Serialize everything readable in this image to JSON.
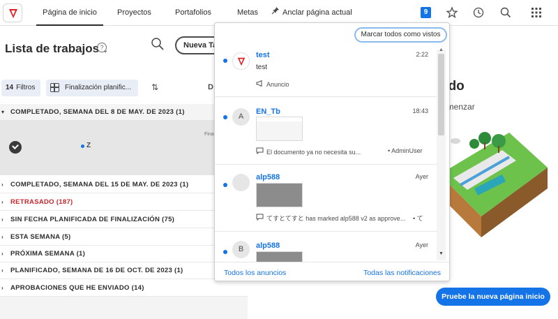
{
  "nav": {
    "tabs": [
      "Página de inicio",
      "Proyectos",
      "Portafolios",
      "Metas"
    ],
    "pin_label": "Anclar página actual",
    "badge_count": "9"
  },
  "work_list": {
    "title": "Lista de trabajos",
    "new_button": "Nueva Ta",
    "filters_count": "14",
    "filters_label": "Filtros",
    "sort_label": "Finalización planific...",
    "column_partial": "D",
    "expanded_row": {
      "label": "Z",
      "column_hint": "Fina"
    },
    "groups": [
      "COMPLETADO, SEMANA DEL 8 DE MAY. DE 2023 (1)",
      "COMPLETADO, SEMANA DEL 15 DE MAY. DE 2023 (1)",
      "RETRASADO (187)",
      "SIN FECHA PLANIFICADA DE FINALIZACIÓN (75)",
      "ESTA SEMANA (5)",
      "PRÓXIMA SEMANA (1)",
      "PLANIFICADO, SEMANA DE 16 DE OCT. DE 2023 (1)",
      "APROBACIONES QUE HE ENVIADO (14)"
    ]
  },
  "right_panel": {
    "heading_partial": "ado",
    "subtext_partial": "omenzar",
    "try_button": "Pruebe la nueva página inicio"
  },
  "notifications": {
    "mark_all": "Marcar todos como vistos",
    "items": [
      {
        "avatar": "",
        "sender": "test",
        "time": "2:22",
        "text": "test",
        "meta": "Anuncio",
        "right": ""
      },
      {
        "avatar": "A",
        "sender": "EN_Tb",
        "time": "18:43",
        "text": "",
        "meta": "El documento ya no necesita su...",
        "right": "• AdminUser"
      },
      {
        "avatar": "",
        "sender": "alp588",
        "time": "Ayer",
        "text": "",
        "meta": "てすとてすと has marked alp588 v2 as approve...",
        "right": "• て"
      },
      {
        "avatar": "B",
        "sender": "alp588",
        "time": "Ayer",
        "text": "",
        "meta": "",
        "right": ""
      }
    ],
    "footer_left": "Todos los anuncios",
    "footer_right": "Todas las notificaciones"
  }
}
